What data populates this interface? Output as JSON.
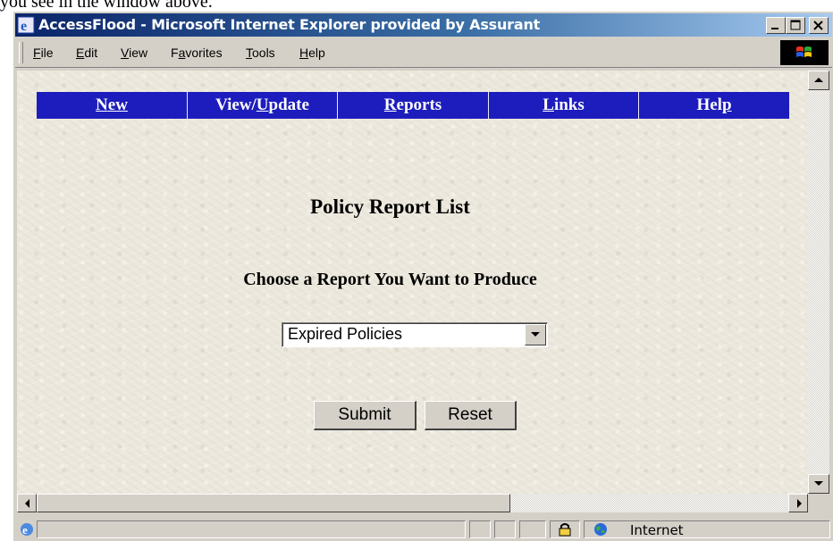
{
  "caption_text": "you see in the window above.",
  "window": {
    "title": "AccessFlood - Microsoft Internet Explorer provided by Assurant"
  },
  "menu": {
    "items": [
      {
        "label": "File",
        "underline": "F",
        "rest": "ile"
      },
      {
        "label": "Edit",
        "underline": "E",
        "rest": "dit"
      },
      {
        "label": "View",
        "underline": "V",
        "rest": "iew"
      },
      {
        "label": "Favorites",
        "underline": "a",
        "pre": "F",
        "rest": "vorites"
      },
      {
        "label": "Tools",
        "underline": "T",
        "rest": "ools"
      },
      {
        "label": "Help",
        "underline": "H",
        "rest": "elp"
      }
    ]
  },
  "nav": {
    "new": {
      "label": "New",
      "underline": "N",
      "rest": "ew"
    },
    "view_update": {
      "label": "View/Update",
      "pre": "View/",
      "underline": "U",
      "rest": "pdate"
    },
    "reports": {
      "label": "Reports",
      "underline": "R",
      "rest": "eports"
    },
    "links": {
      "label": "Links",
      "underline": "L",
      "rest": "inks"
    },
    "help": {
      "label": "Help",
      "pre": "Hel",
      "underline": "p",
      "rest": ""
    }
  },
  "page": {
    "title": "Policy Report List",
    "prompt": "Choose a Report You Want to Produce",
    "report_select": {
      "selected": "Expired Policies"
    },
    "submit_label": "Submit",
    "reset_label": "Reset"
  },
  "status": {
    "zone": "Internet"
  },
  "colors": {
    "nav_background": "#1d1dbd",
    "titlebar_start": "#0a246a",
    "titlebar_end": "#a6caf0"
  }
}
